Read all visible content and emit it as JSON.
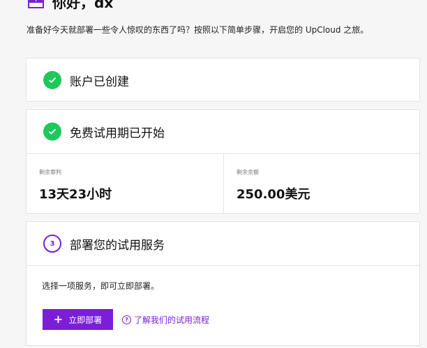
{
  "header": {
    "greeting": "你好，dx",
    "subtitle": "准备好今天就部署一些令人惊叹的东西了吗？按照以下简单步骤，开启您的 UpCloud 之旅。"
  },
  "steps": {
    "account": {
      "title": "账户已创建",
      "status": "done"
    },
    "trial": {
      "title": "免费试用期已开始",
      "status": "done",
      "remaining_time_label": "剩余审判",
      "remaining_time_value": "13天23小时",
      "remaining_balance_label": "剩余余额",
      "remaining_balance_value": "250.00美元"
    },
    "deploy": {
      "number": "3",
      "title": "部署您的试用服务",
      "description": "选择一项服务，即可立即部署。",
      "button_label": "立即部署",
      "link_label": "了解我们的试用流程"
    }
  },
  "colors": {
    "accent": "#7a1fd6",
    "success": "#1ec85a"
  }
}
